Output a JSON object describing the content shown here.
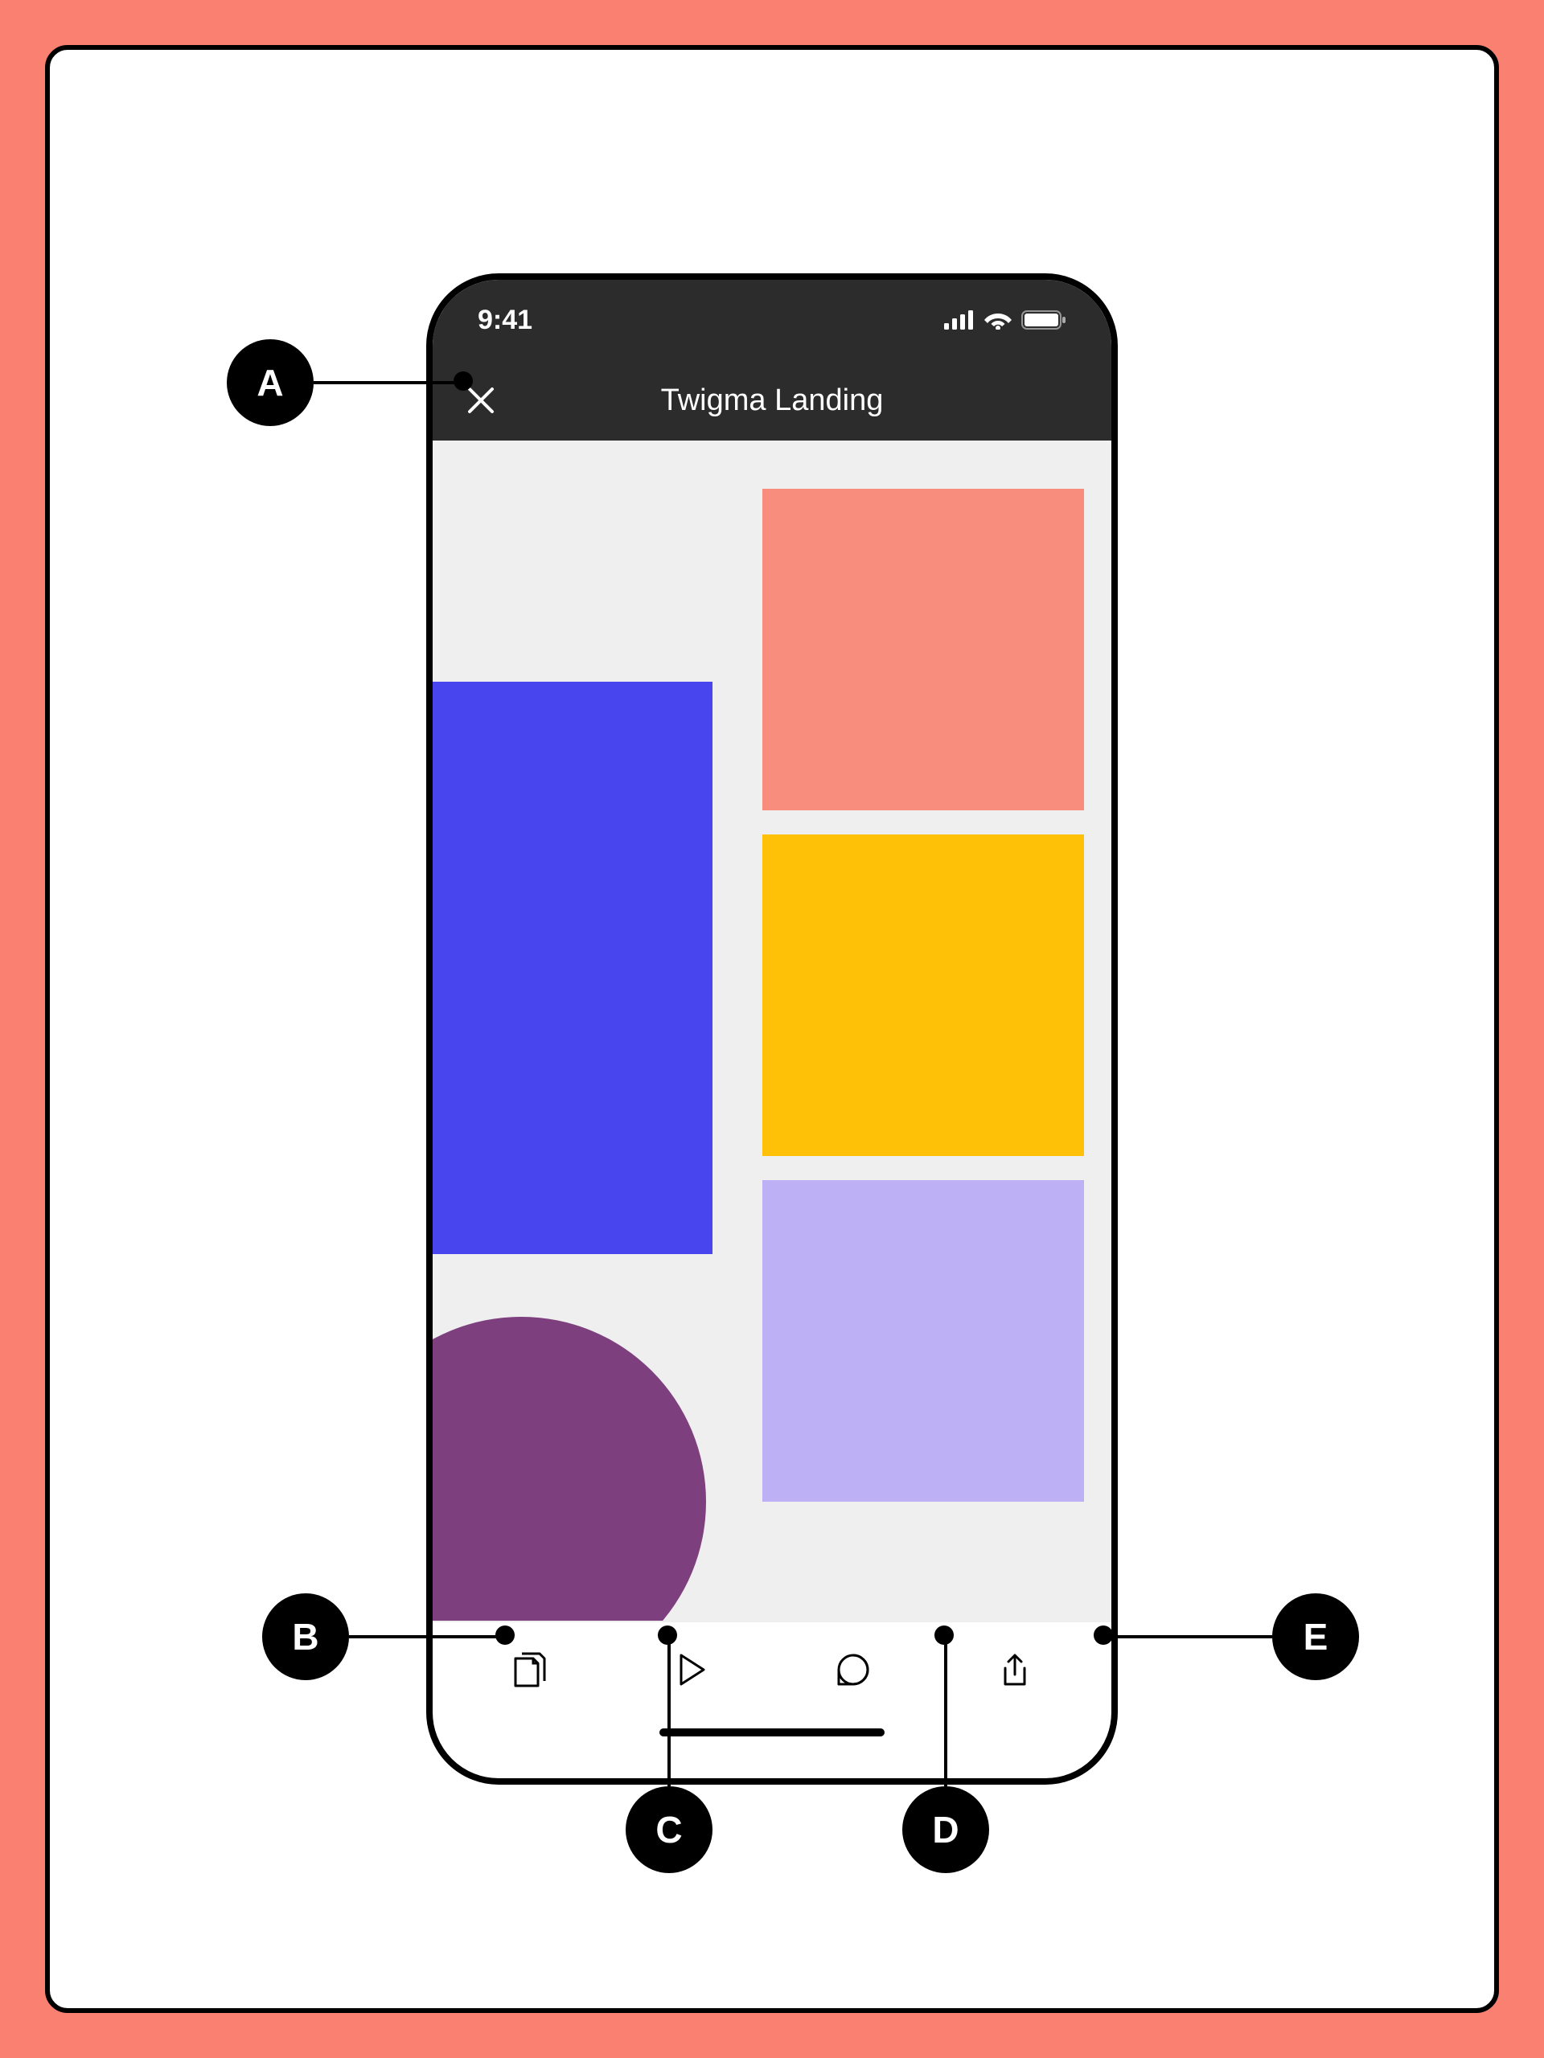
{
  "status_bar": {
    "time": "9:41"
  },
  "header": {
    "title": "Twigma Landing"
  },
  "callouts": [
    {
      "label": "A",
      "target": "close-button"
    },
    {
      "label": "B",
      "target": "pages-tool"
    },
    {
      "label": "C",
      "target": "play-tool"
    },
    {
      "label": "D",
      "target": "comment-tool"
    },
    {
      "label": "E",
      "target": "share-tool"
    }
  ],
  "canvas": {
    "shapes": [
      {
        "id": "blue-rect",
        "color": "#4945EE"
      },
      {
        "id": "coral-rect",
        "color": "#F98D7D"
      },
      {
        "id": "gold-rect",
        "color": "#FFC107"
      },
      {
        "id": "lilac-rect",
        "color": "#BEB0F4"
      },
      {
        "id": "purple-circle",
        "color": "#7E3F7E"
      }
    ]
  },
  "toolbar": {
    "tools": [
      {
        "id": "pages",
        "icon": "pages-icon"
      },
      {
        "id": "play",
        "icon": "play-icon"
      },
      {
        "id": "comment",
        "icon": "comment-icon"
      },
      {
        "id": "share",
        "icon": "share-icon"
      }
    ]
  }
}
